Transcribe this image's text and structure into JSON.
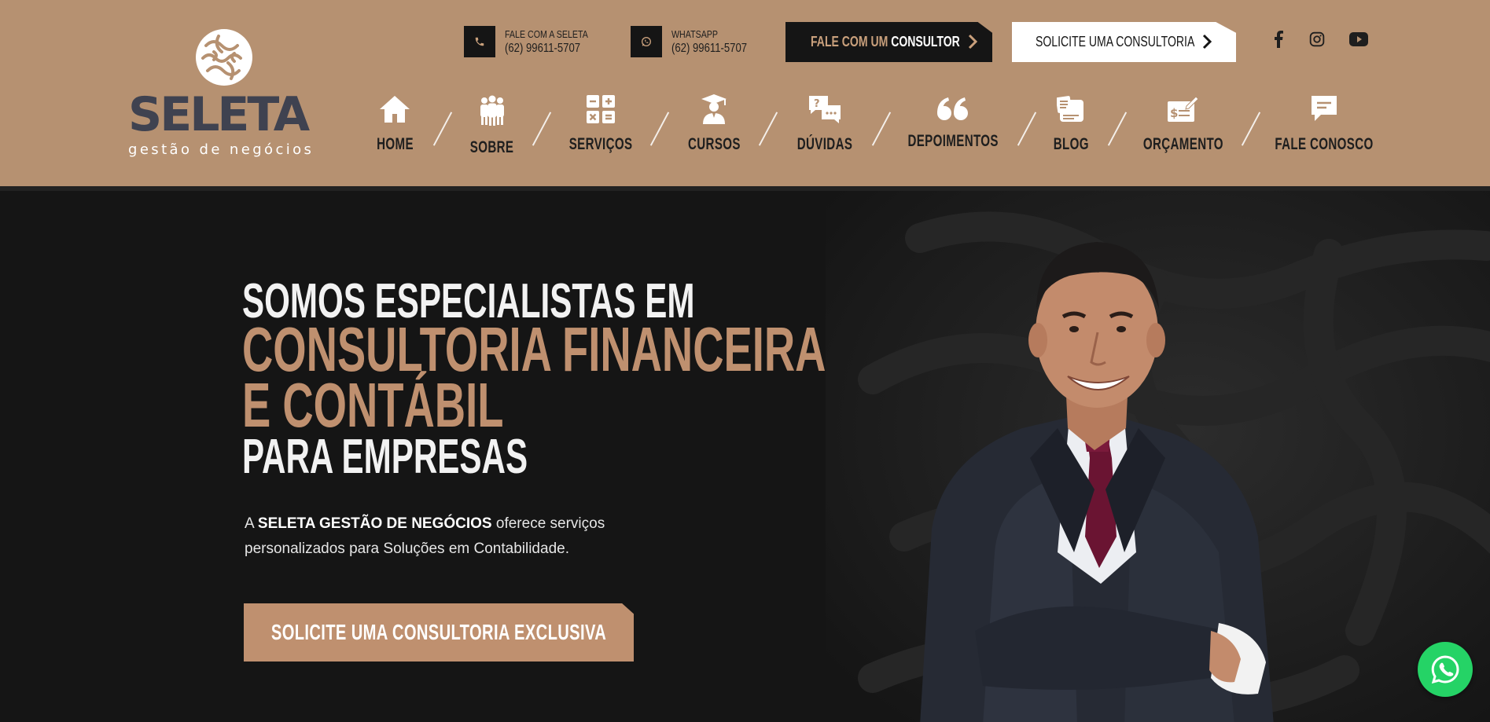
{
  "brand": {
    "name": "SELETA",
    "tagline": "gestão de negócios"
  },
  "contacts": [
    {
      "label": "FALE COM A SELETA",
      "phone": "(62) 99611-5707",
      "icon": "phone-icon"
    },
    {
      "label": "WHATSAPP",
      "phone": "(62) 99611-5707",
      "icon": "whatsapp-icon"
    }
  ],
  "buttons": {
    "consultor_prefix": "FALE COM UM",
    "consultor_bold": "CONSULTOR",
    "solicite": "SOLICITE UMA CONSULTORIA"
  },
  "social": [
    "facebook-icon",
    "instagram-icon",
    "youtube-icon"
  ],
  "nav": [
    {
      "label": "HOME",
      "icon": "home-icon"
    },
    {
      "label": "SOBRE",
      "icon": "team-icon"
    },
    {
      "label": "SERVIÇOS",
      "icon": "calculator-icon"
    },
    {
      "label": "CURSOS",
      "icon": "graduate-icon"
    },
    {
      "label": "DÚVIDAS",
      "icon": "question-chat-icon"
    },
    {
      "label": "DEPOIMENTOS",
      "icon": "quote-icon"
    },
    {
      "label": "BLOG",
      "icon": "blog-icon"
    },
    {
      "label": "ORÇAMENTO",
      "icon": "budget-icon"
    },
    {
      "label": "FALE CONOSCO",
      "icon": "message-icon"
    }
  ],
  "hero": {
    "line1": "SOMOS ESPECIALISTAS EM",
    "line2": "CONSULTORIA FINANCEIRA",
    "line3": "E CONTÁBIL",
    "line4": "PARA EMPRESAS",
    "desc_prefix": "A ",
    "desc_bold": "SELETA GESTÃO DE NEGÓCIOS",
    "desc_suffix": " oferece serviços personalizados para Soluções em Contabilidade.",
    "cta": "SOLICITE UMA CONSULTORIA EXCLUSIVA"
  },
  "colors": {
    "header_bg": "#b69171",
    "accent": "#bf906f",
    "dark": "#151515",
    "whatsapp": "#25d366"
  }
}
